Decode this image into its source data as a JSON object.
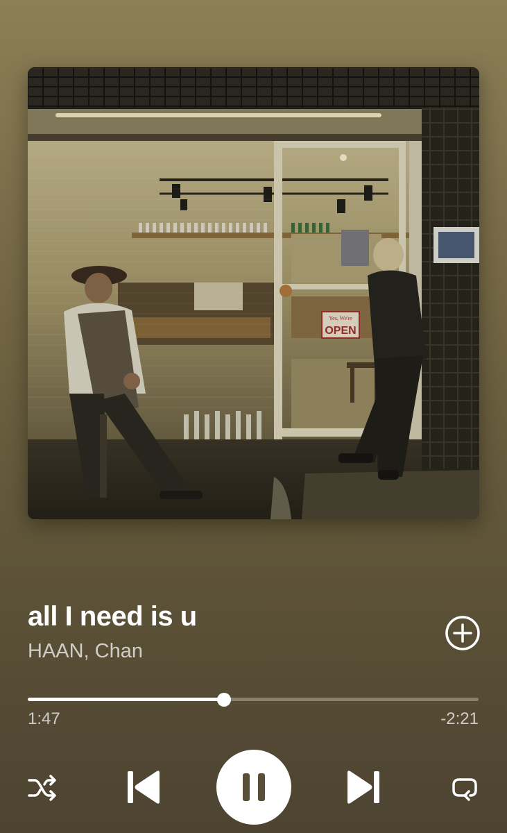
{
  "track": {
    "title": "all I need is u",
    "artist": "HAAN, Chan",
    "artwork": {
      "icon": "album-artwork",
      "storefront_sign": "Yes, We're OPEN"
    }
  },
  "playback": {
    "elapsed": "1:47",
    "remaining": "-2:21",
    "progress_fraction": 0.435,
    "state": "playing"
  },
  "controls": {
    "add_icon": "add-circle-icon",
    "shuffle_icon": "shuffle-icon",
    "previous_icon": "skip-previous-icon",
    "play_pause_icon": "pause-icon",
    "next_icon": "skip-next-icon",
    "repeat_icon": "repeat-icon"
  },
  "colors": {
    "background_top": "#8c7f56",
    "background_bottom": "#4c4331",
    "foreground": "#ffffff",
    "secondary_text": "#d6d1c2"
  }
}
